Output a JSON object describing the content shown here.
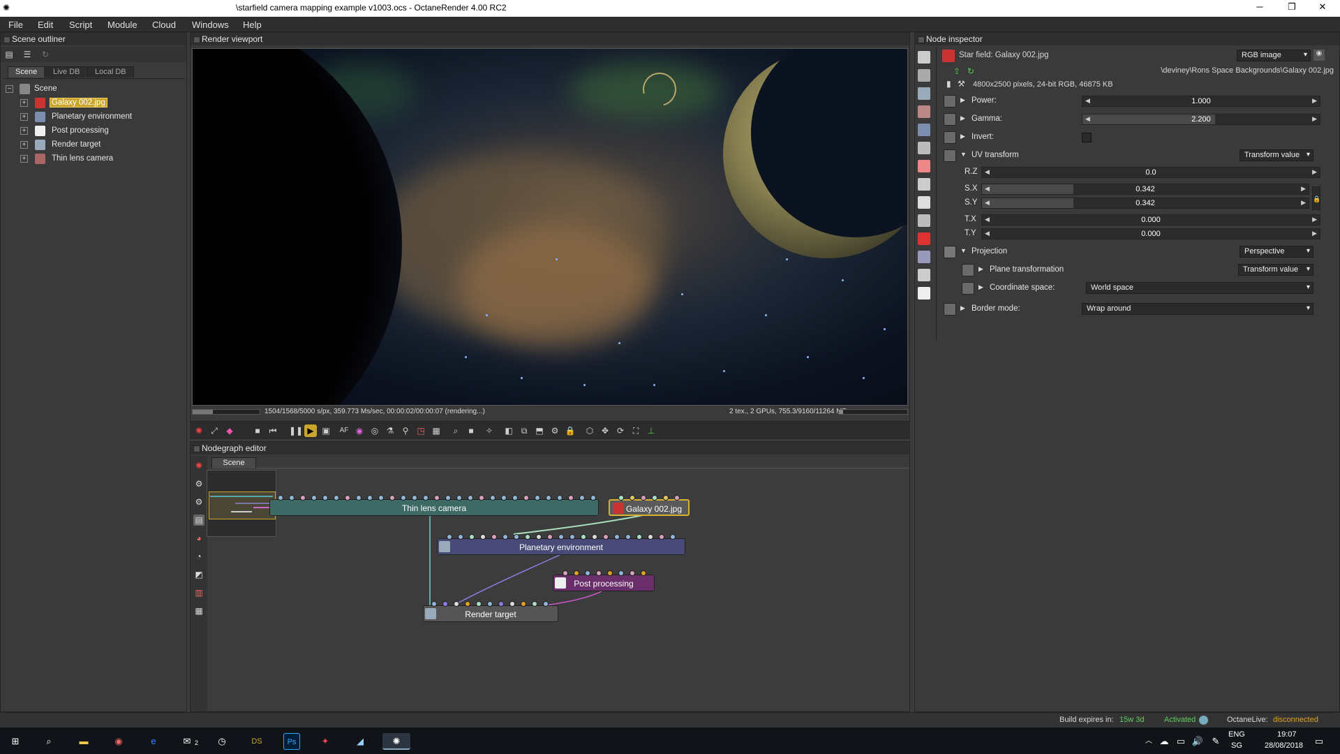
{
  "window": {
    "title": "\\starfield camera mapping example v1003.ocs - OctaneRender 4.00 RC2",
    "minimize": "─",
    "maximize": "❐",
    "close": "✕"
  },
  "menu": [
    "File",
    "Edit",
    "Script",
    "Module",
    "Cloud",
    "Windows",
    "Help"
  ],
  "outliner": {
    "title": "Scene outliner",
    "tabs": [
      "Scene",
      "Live DB",
      "Local DB"
    ],
    "root": "Scene",
    "items": [
      {
        "label": "Galaxy 002.jpg",
        "icon": "image-texture-icon",
        "selected": true
      },
      {
        "label": "Planetary environment",
        "icon": "environment-icon",
        "selected": false
      },
      {
        "label": "Post processing",
        "icon": "post-processing-icon",
        "selected": false
      },
      {
        "label": "Render target",
        "icon": "render-target-icon",
        "selected": false
      },
      {
        "label": "Thin lens camera",
        "icon": "camera-icon",
        "selected": false
      }
    ]
  },
  "viewport": {
    "title": "Render viewport",
    "status_left": "1504/1568/5000 s/px, 359.773 Ms/sec, 00:00:02/00:00:07 (rendering...)",
    "status_right": "2 tex., 2 GPUs, 755.3/9160/11264 MB",
    "progress": 0.3
  },
  "nodegraph": {
    "title": "Nodegraph editor",
    "tab": "Scene",
    "nodes": [
      {
        "id": "camera",
        "label": "Thin lens camera",
        "color": "#3e6a66"
      },
      {
        "id": "galaxy",
        "label": "Galaxy 002.jpg",
        "color": "#5a5a5a",
        "border": "#d9b230"
      },
      {
        "id": "planetary",
        "label": "Planetary environment",
        "color": "#4a4a78"
      },
      {
        "id": "post",
        "label": "Post processing",
        "color": "#6a2f6a"
      },
      {
        "id": "render",
        "label": "Render target",
        "color": "#555555"
      }
    ]
  },
  "inspector": {
    "title": "Node inspector",
    "node_title": "Star field: Galaxy 002.jpg",
    "node_type": "RGB image",
    "file_path": "\\deviney\\Rons Space Backgrounds\\Galaxy 002.jpg",
    "file_info": "4800x2500 pixels, 24-bit RGB, 46875 KB",
    "power": {
      "label": "Power:",
      "value": "1.000"
    },
    "gamma": {
      "label": "Gamma:",
      "value": "2.200"
    },
    "invert": {
      "label": "Invert:"
    },
    "uv_transform": {
      "label": "UV transform",
      "mode": "Transform value",
      "rz": {
        "label": "R.Z",
        "value": "0.0"
      },
      "sx": {
        "label": "S.X",
        "value": "0.342"
      },
      "sy": {
        "label": "S.Y",
        "value": "0.342"
      },
      "tx": {
        "label": "T.X",
        "value": "0.000"
      },
      "ty": {
        "label": "T.Y",
        "value": "0.000"
      }
    },
    "projection": {
      "label": "Projection",
      "mode": "Perspective",
      "plane_transformation": {
        "label": "Plane transformation",
        "mode": "Transform value"
      },
      "coordinate_space": {
        "label": "Coordinate space:",
        "mode": "World space"
      }
    },
    "border_mode": {
      "label": "Border mode:",
      "mode": "Wrap around"
    }
  },
  "statusbar": {
    "build_label": "Build expires in:",
    "build_value": "15w 3d",
    "activated": "Activated",
    "octanelive_label": "OctaneLive:",
    "octanelive_value": "disconnected"
  },
  "taskbar": {
    "lang": "ENG",
    "region": "SG",
    "time": "19:07",
    "date": "28/08/2018",
    "mail_badge": "2",
    "apps": [
      "start-icon",
      "search-icon",
      "file-explorer-icon",
      "chrome-icon",
      "edge-icon",
      "mail-icon",
      "clock-app-icon",
      "ds-icon",
      "photoshop-icon",
      "app-icon",
      "app-icon-2",
      "octane-icon"
    ]
  }
}
